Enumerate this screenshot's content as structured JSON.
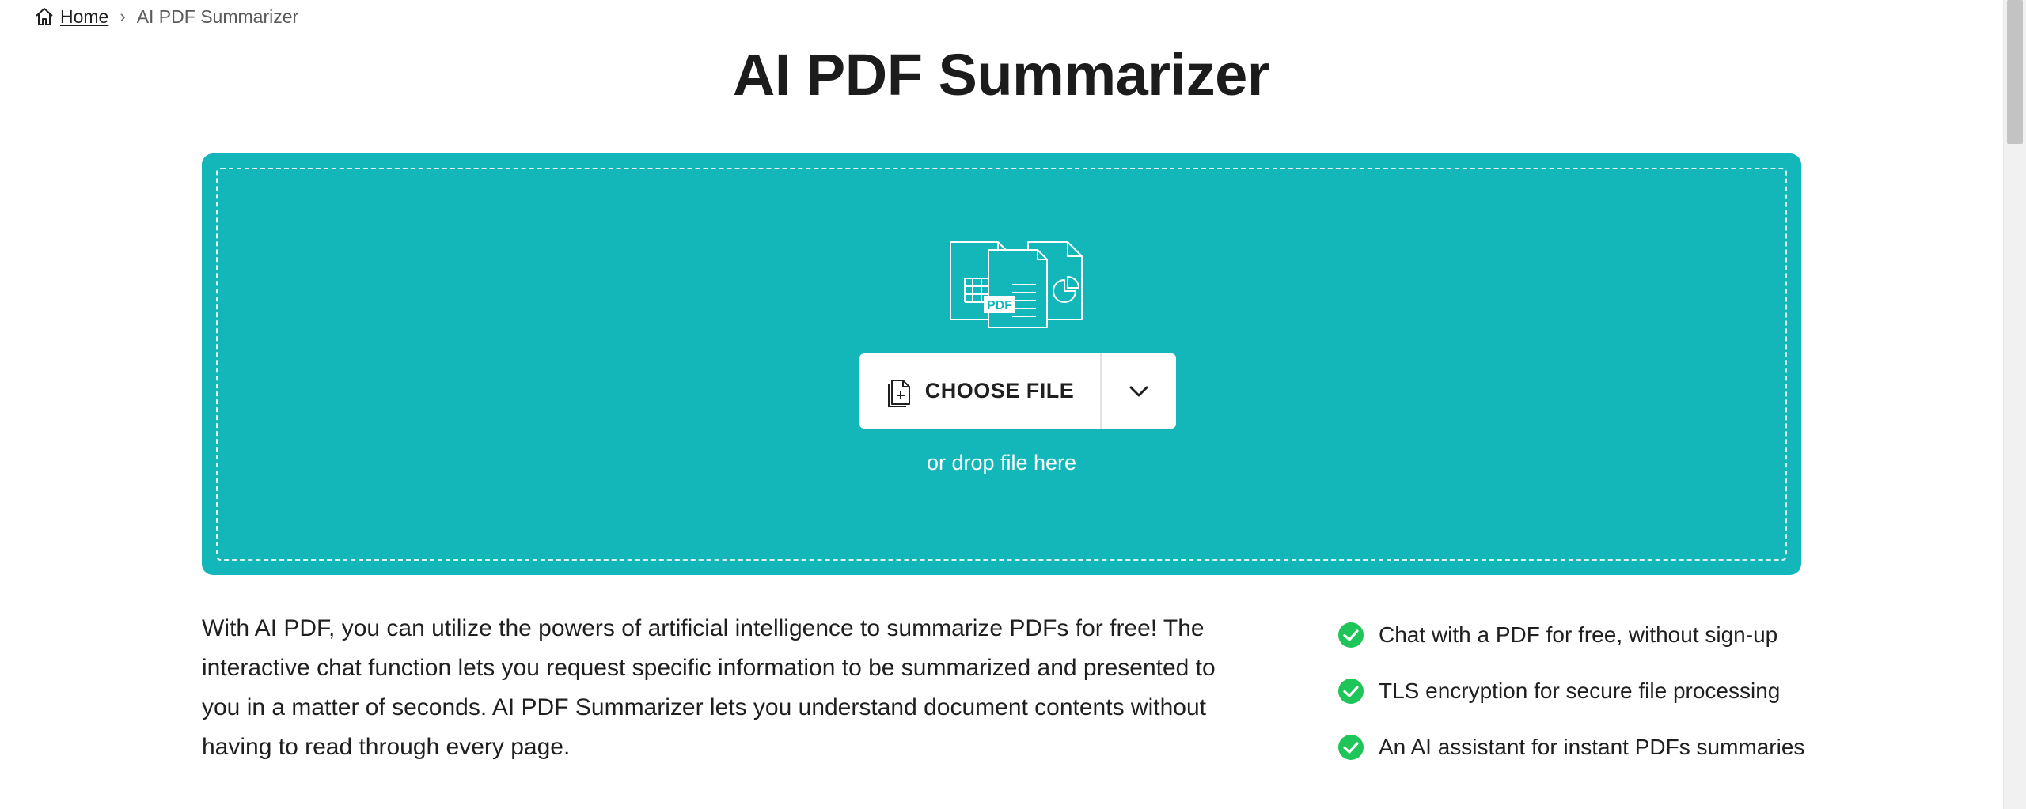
{
  "breadcrumb": {
    "home_label": "Home",
    "separator": "›",
    "current_label": "AI PDF Summarizer"
  },
  "page": {
    "title": "AI PDF Summarizer"
  },
  "upload": {
    "illustration_text": "PDF",
    "choose_file_label": "CHOOSE FILE",
    "drop_hint": "or drop file here",
    "panel_color": "#14b7b9"
  },
  "description": "With AI PDF, you can utilize the powers of artificial intelligence to summarize PDFs for free! The interactive chat function lets you request specific information to be summarized and presented to you in a matter of seconds. AI PDF Summarizer lets you understand document contents without having to read through every page.",
  "features": [
    {
      "icon": "check-circle-icon",
      "label": "Chat with a PDF for free, without sign-up"
    },
    {
      "icon": "check-circle-icon",
      "label": "TLS encryption for secure file processing"
    },
    {
      "icon": "check-circle-icon",
      "label": "An AI assistant for instant PDFs summaries"
    }
  ],
  "colors": {
    "accent": "#14b7b9",
    "check": "#1ec65a"
  }
}
